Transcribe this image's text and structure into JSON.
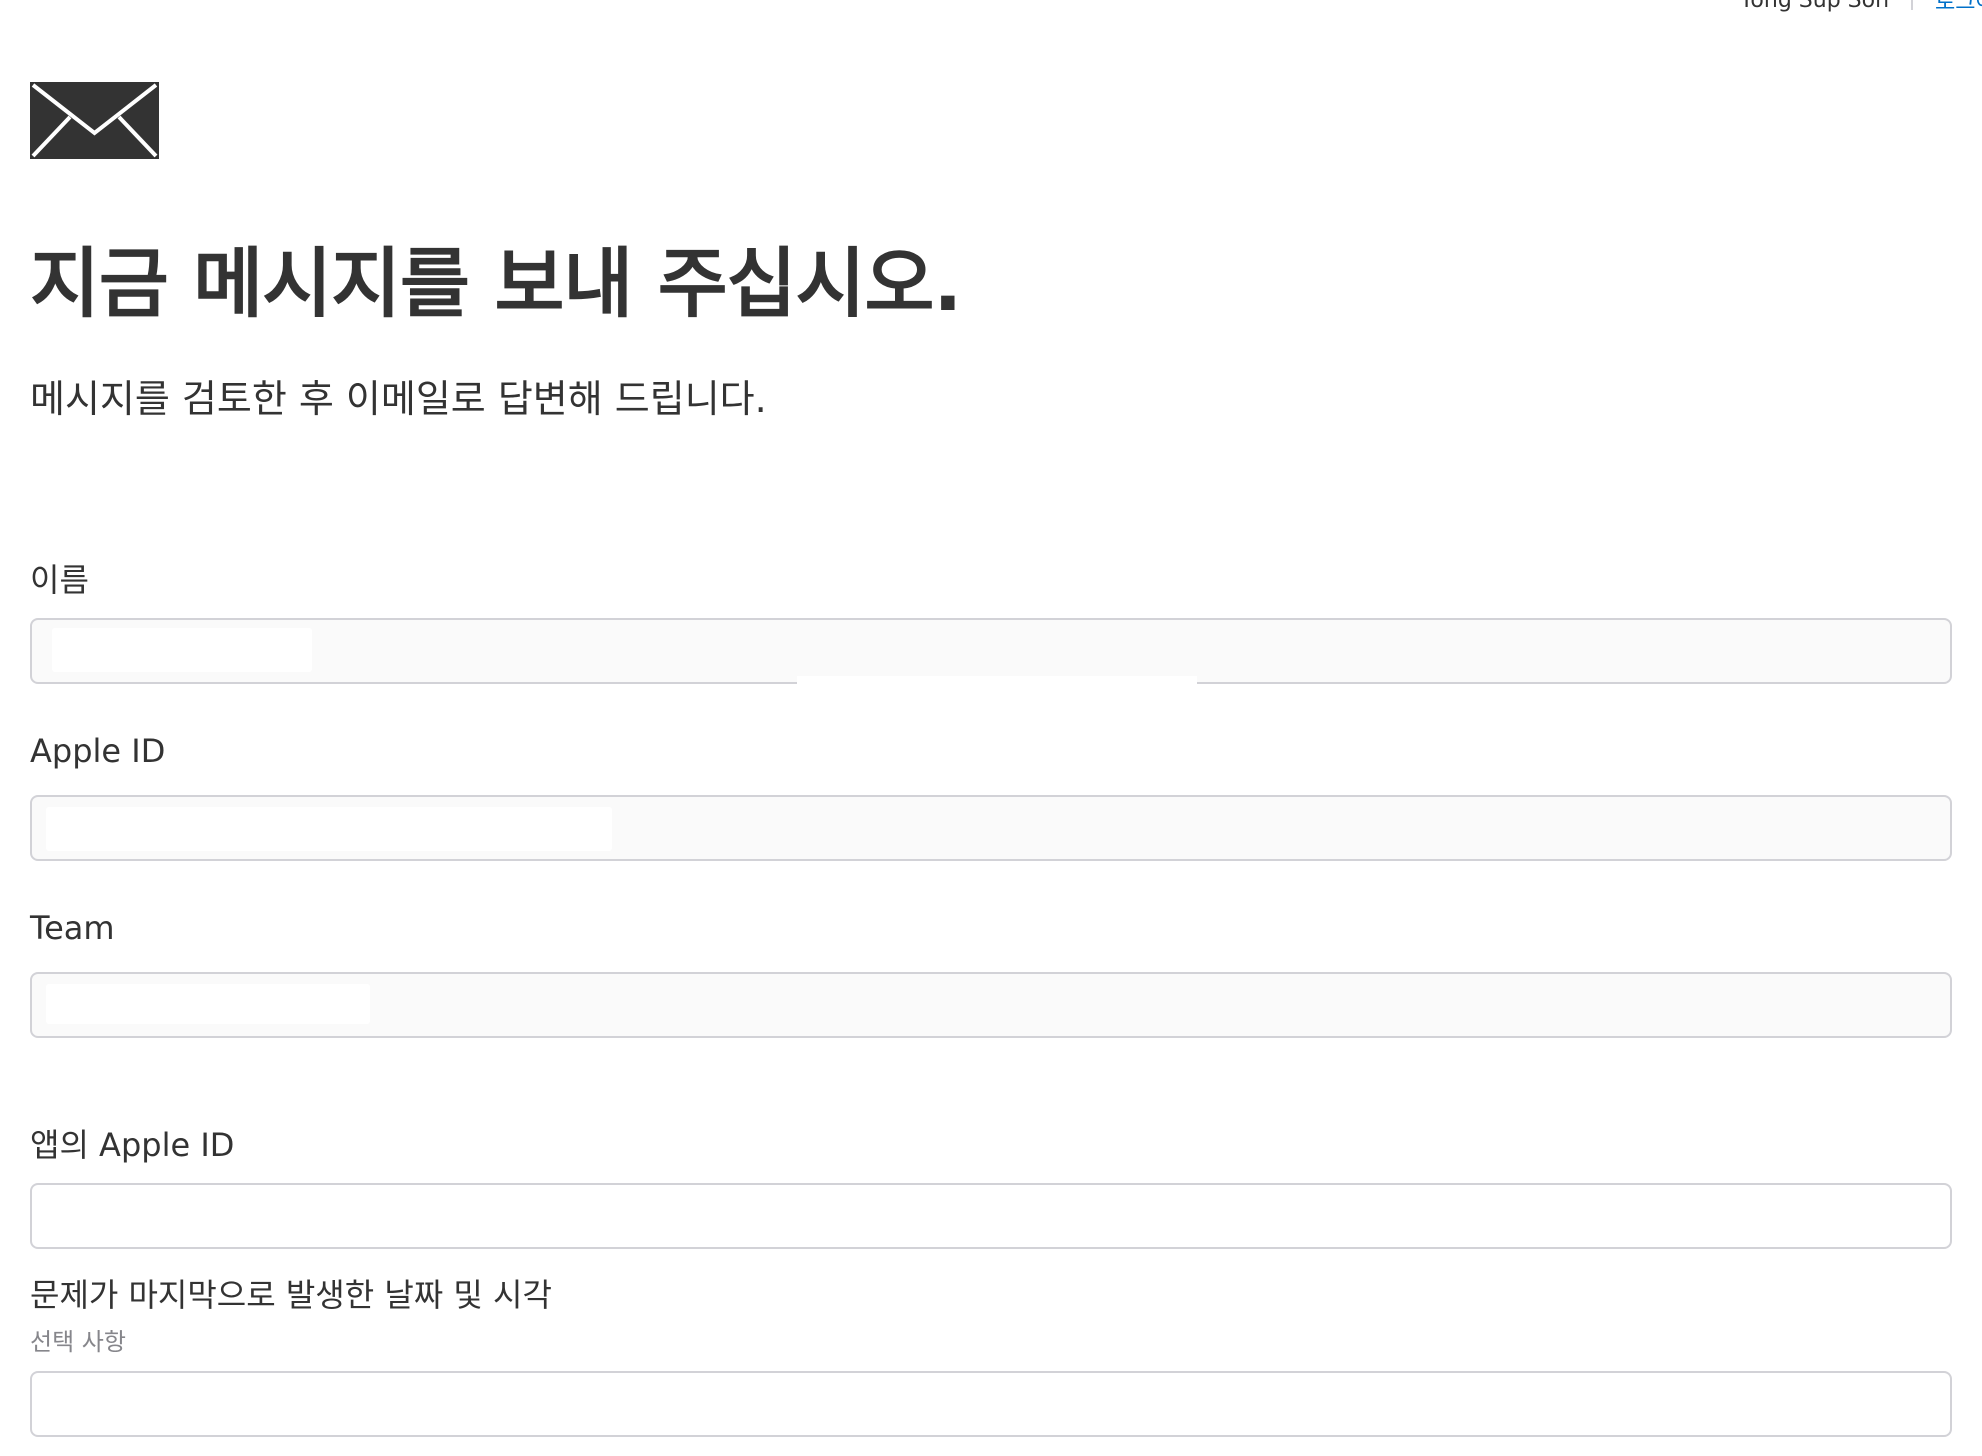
{
  "header": {
    "user_name": "Yong Sup Son",
    "logout_label": "로그아웃"
  },
  "page": {
    "icon": "envelope-icon",
    "title": "지금 메시지를 보내 주십시오.",
    "subtitle": "메시지를 검토한 후 이메일로 답변해 드립니다."
  },
  "form": {
    "name_label": "이름",
    "apple_id_label": "Apple ID",
    "team_label": "Team",
    "app_apple_id_label": "앱의 Apple ID",
    "app_apple_id_value": "",
    "date_time_label": "문제가 마지막으로 발생한 날짜 및 시각",
    "date_time_hint": "선택 사항",
    "date_time_value": ""
  },
  "colors": {
    "text": "#333333",
    "link": "#0070c9",
    "border": "#d2d2d7",
    "readonly_background": "#fafafa",
    "hint": "#86868b"
  }
}
